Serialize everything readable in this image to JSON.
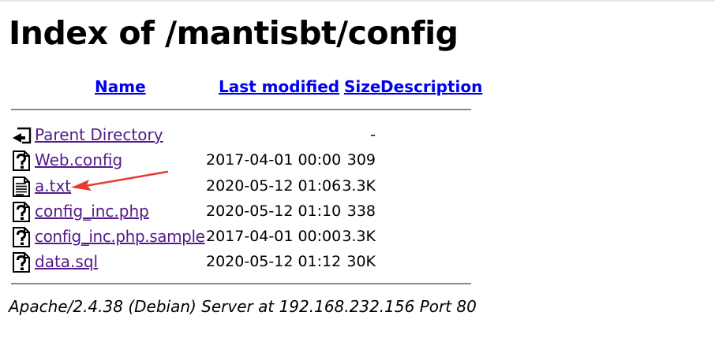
{
  "page": {
    "title": "Index of /mantisbt/config"
  },
  "columns": {
    "name": "Name",
    "last_modified": "Last modified",
    "size": "Size",
    "description": "Description"
  },
  "rows": [
    {
      "icon": "back-icon",
      "name": "Parent Directory",
      "modified": "",
      "size": "-"
    },
    {
      "icon": "unknown-icon",
      "name": "Web.config",
      "modified": "2017-04-01 00:00",
      "size": "309"
    },
    {
      "icon": "text-icon",
      "name": "a.txt",
      "modified": "2020-05-12 01:06",
      "size": "3.3K"
    },
    {
      "icon": "unknown-icon",
      "name": "config_inc.php",
      "modified": "2020-05-12 01:10",
      "size": "338"
    },
    {
      "icon": "unknown-icon",
      "name": "config_inc.php.sample",
      "modified": "2017-04-01 00:00",
      "size": "3.3K"
    },
    {
      "icon": "unknown-icon",
      "name": "data.sql",
      "modified": "2020-05-12 01:12",
      "size": "30K"
    }
  ],
  "footer": {
    "address": "Apache/2.4.38 (Debian) Server at 192.168.232.156 Port 80"
  },
  "colors": {
    "link": "#0000ee",
    "visited": "#551a8b",
    "annotation": "#e8392f"
  },
  "annotation": {
    "type": "red-arrow",
    "points_to": "a.txt"
  }
}
